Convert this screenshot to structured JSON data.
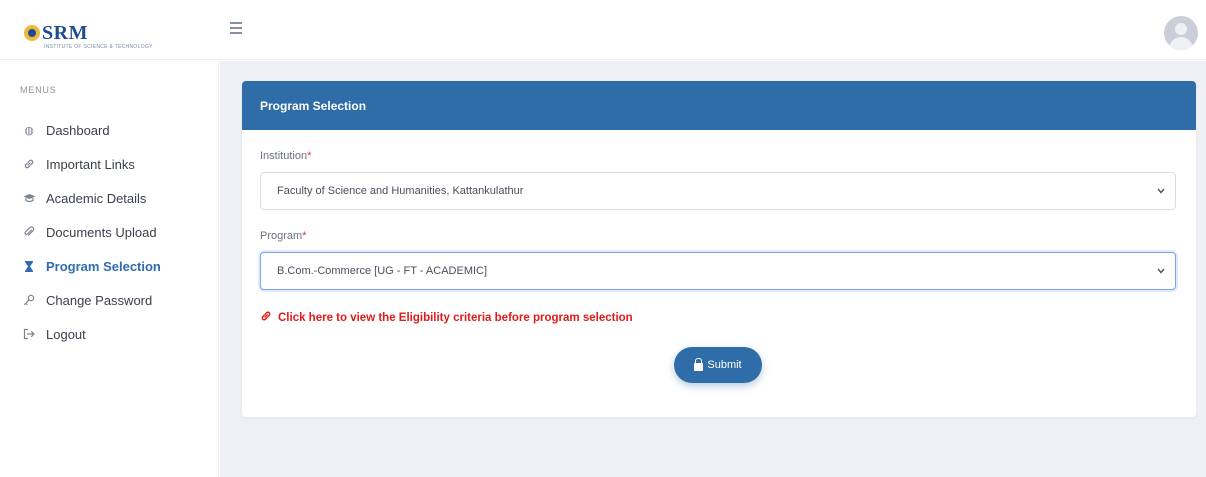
{
  "brand": {
    "name": "SRM",
    "subtitle": "INSTITUTE OF SCIENCE & TECHNOLOGY"
  },
  "topbar": {
    "menu_icon": "hamburger-icon",
    "avatar_icon": "user-avatar-icon"
  },
  "sidebar": {
    "heading": "MENUS",
    "items": [
      {
        "label": "Dashboard",
        "icon": "dashboard-icon",
        "glyph": "◍"
      },
      {
        "label": "Important Links",
        "icon": "link-icon",
        "glyph": "🔗"
      },
      {
        "label": "Academic Details",
        "icon": "graduation-cap-icon",
        "glyph": "≘"
      },
      {
        "label": "Documents Upload",
        "icon": "paperclip-icon",
        "glyph": "⌇"
      },
      {
        "label": "Program Selection",
        "icon": "hourglass-icon",
        "glyph": "⧗",
        "active": true
      },
      {
        "label": "Change Password",
        "icon": "key-icon",
        "glyph": "⚷"
      },
      {
        "label": "Logout",
        "icon": "logout-icon",
        "glyph": "⇥"
      }
    ]
  },
  "card": {
    "title": "Program Selection",
    "institution": {
      "label": "Institution",
      "required_mark": "*",
      "value": "Faculty of Science and Humanities, Kattankulathur"
    },
    "program": {
      "label": "Program",
      "required_mark": "*",
      "value": "B.Com.-Commerce [UG - FT - ACADEMIC]"
    },
    "eligibility_link": "Click here to view the Eligibility criteria before program selection",
    "submit_label": "Submit"
  },
  "colors": {
    "primary": "#2e6da8",
    "active_nav": "#2f6db0",
    "link_red": "#e01b1b",
    "content_bg": "#eef0f5"
  }
}
